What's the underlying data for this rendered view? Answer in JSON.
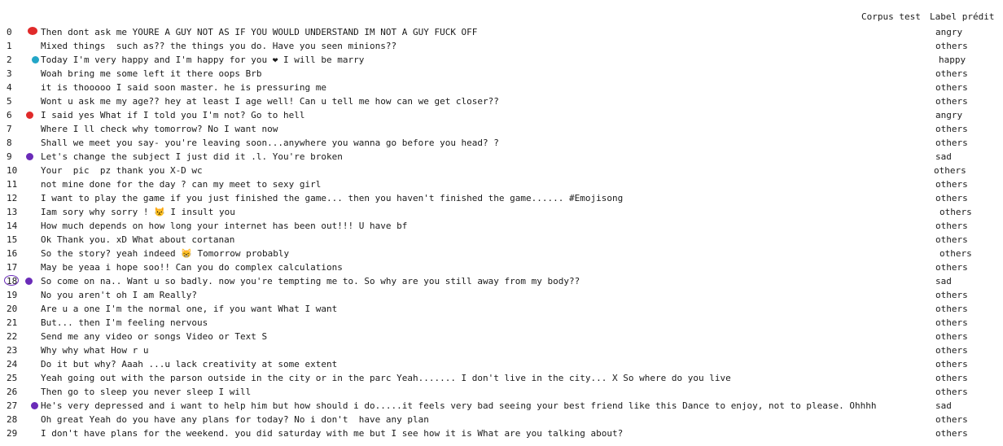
{
  "header": {
    "col_text": "Corpus test",
    "col_label": "Label prédit"
  },
  "colors": {
    "angry": "#e02a2a",
    "happy": "#23a6c7",
    "sad": "#6a2bb8"
  },
  "rows": [
    {
      "idx": "0",
      "text": "Then dont ask me YOURE A GUY NOT AS IF YOU WOULD UNDERSTAND IM NOT A GUY FUCK OFF",
      "label": "angry",
      "marker": "angry",
      "big": true
    },
    {
      "idx": "1",
      "text": "Mixed things  such as?? the things you do. Have you seen minions??",
      "label": "others"
    },
    {
      "idx": "2",
      "text": "Today I'm very happy and I'm happy for you ❤ I will be marry",
      "label": "happy",
      "marker": "happy"
    },
    {
      "idx": "3",
      "text": "Woah bring me some left it there oops Brb",
      "label": "others"
    },
    {
      "idx": "4",
      "text": "it is thooooo I said soon master. he is pressuring me",
      "label": "others"
    },
    {
      "idx": "5",
      "text": "Wont u ask me my age?? hey at least I age well! Can u tell me how can we get closer??",
      "label": "others"
    },
    {
      "idx": "6",
      "text": "I said yes What if I told you I'm not? Go to hell",
      "label": "angry",
      "marker": "angry"
    },
    {
      "idx": "7",
      "text": "Where I ll check why tomorrow? No I want now",
      "label": "others"
    },
    {
      "idx": "8",
      "text": "Shall we meet you say- you're leaving soon...anywhere you wanna go before you head? ?",
      "label": "others"
    },
    {
      "idx": "9",
      "text": "Let's change the subject I just did it .l. You're broken",
      "label": "sad",
      "marker": "sad"
    },
    {
      "idx": "10",
      "text": "Your  pic  pz thank you X-D wc",
      "label": "others"
    },
    {
      "idx": "11",
      "text": "not mine done for the day ? can my meet to sexy girl",
      "label": "others"
    },
    {
      "idx": "12",
      "text": "I want to play the game if you just finished the game... then you haven't finished the game...... #Emojisong",
      "label": "others"
    },
    {
      "idx": "13",
      "text": "Iam sory why sorry ! 😾 I insult you",
      "label": "others"
    },
    {
      "idx": "14",
      "text": "How much depends on how long your internet has been out!!! U have bf",
      "label": "others"
    },
    {
      "idx": "15",
      "text": "Ok Thank you. xD What about cortanan",
      "label": "others"
    },
    {
      "idx": "16",
      "text": "So the story? yeah indeed 😸 Tomorrow probably",
      "label": "others"
    },
    {
      "idx": "17",
      "text": "May be yeaa i hope soo!! Can you do complex calculations",
      "label": "others"
    },
    {
      "idx": "18",
      "text": "So come on na.. Want u so badly. now you're tempting me to. So why are you still away from my body??",
      "label": "sad",
      "marker": "sad",
      "circled": true
    },
    {
      "idx": "19",
      "text": "No you aren't oh I am Really?",
      "label": "others"
    },
    {
      "idx": "20",
      "text": "Are u a one I'm the normal one, if you want What I want",
      "label": "others"
    },
    {
      "idx": "21",
      "text": "But... then I'm feeling nervous",
      "label": "others"
    },
    {
      "idx": "22",
      "text": "Send me any video or songs Video or Text S",
      "label": "others"
    },
    {
      "idx": "23",
      "text": "Why why what How r u",
      "label": "others"
    },
    {
      "idx": "24",
      "text": "Do it but why? Aaah ...u lack creativity at some extent",
      "label": "others"
    },
    {
      "idx": "25",
      "text": "Yeah going out with the parson outside in the city or in the parc Yeah....... I don't live in the city... X So where do you live",
      "label": "others"
    },
    {
      "idx": "26",
      "text": "Then go to sleep you never sleep I will",
      "label": "others"
    },
    {
      "idx": "27",
      "text": "He's very depressed and i want to help him but how should i do.....it feels very bad seeing your best friend like this Dance to enjoy, not to please. Ohhhh",
      "label": "sad",
      "marker": "sad"
    },
    {
      "idx": "28",
      "text": "Oh great Yeah do you have any plans for today? No i don't  have any plan",
      "label": "others"
    },
    {
      "idx": "29",
      "text": "I don't have plans for the weekend. you did saturday with me but I see how it is What are you talking about?",
      "label": "others"
    }
  ]
}
